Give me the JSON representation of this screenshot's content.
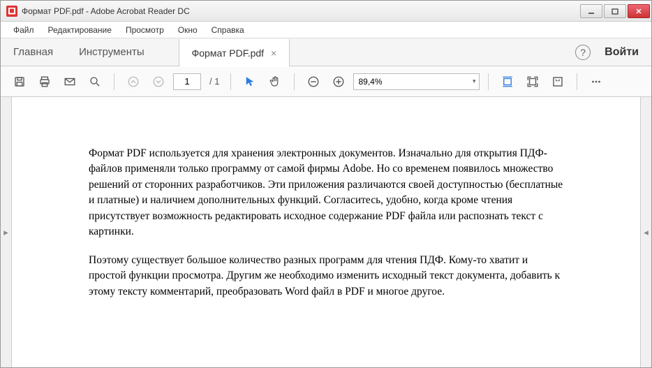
{
  "window": {
    "title": "Формат PDF.pdf - Adobe Acrobat Reader DC"
  },
  "menu": {
    "file": "Файл",
    "edit": "Редактирование",
    "view": "Просмотр",
    "window": "Окно",
    "help": "Справка"
  },
  "tabs": {
    "home": "Главная",
    "tools": "Инструменты",
    "document": "Формат PDF.pdf",
    "login": "Войти"
  },
  "toolbar": {
    "page_current": "1",
    "page_total": "/ 1",
    "zoom": "89,4%"
  },
  "document": {
    "para1": "Формат PDF используется для хранения электронных документов. Изначально для открытия ПДФ-файлов применяли только программу от самой фирмы Adobe. Но со временем появилось множество решений от сторонних разработчиков. Эти приложения различаются своей доступностью (бесплатные и платные) и наличием дополнительных функций. Согласитесь, удобно, когда кроме чтения присутствует возможность редактировать исходное содержание PDF файла или распознать текст с картинки.",
    "para2": "Поэтому существует большое количество разных программ для чтения ПДФ. Кому-то хватит и простой функции просмотра. Другим же необходимо изменить исходный текст документа, добавить к этому тексту комментарий, преобразовать Word файл в PDF и многое другое."
  }
}
